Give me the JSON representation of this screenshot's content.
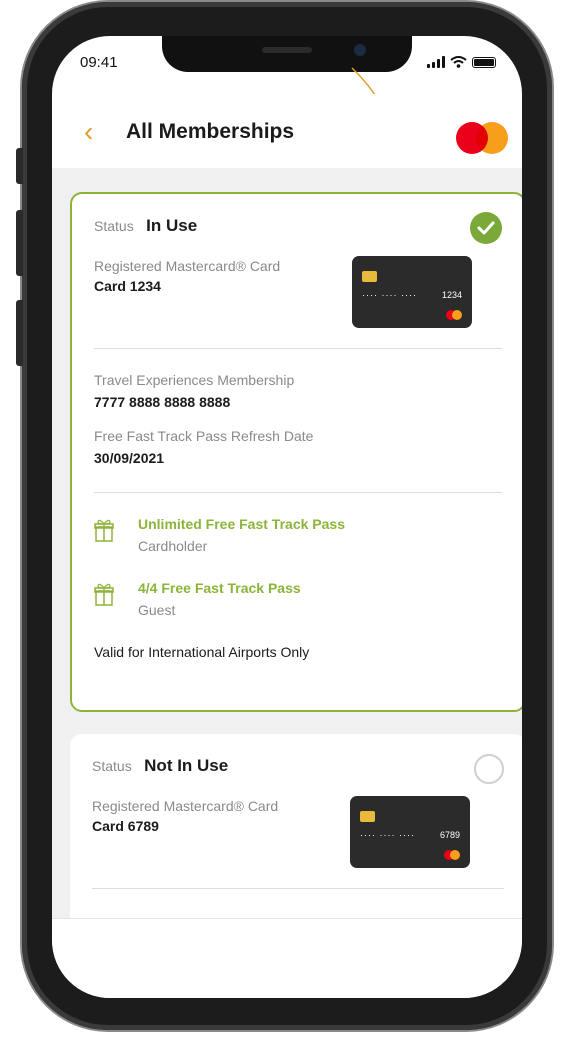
{
  "statusbar": {
    "time": "09:41"
  },
  "header": {
    "back_icon": "‹",
    "title": "All Memberships"
  },
  "colors": {
    "accent": "#e29c2b",
    "green": "#8cb43a",
    "mc_red": "#eb001b",
    "mc_yellow": "#f79e1b"
  },
  "memberships": [
    {
      "status_label": "Status",
      "status": "In Use",
      "card_label": "Registered Mastercard® Card",
      "card_name": "Card 1234",
      "card_dots": "···· ···· ····",
      "card_last4": "1234",
      "membership_label": "Travel Experiences Membership",
      "membership_number": "7777 8888 8888 8888",
      "refresh_label": "Free Fast Track Pass Refresh Date",
      "refresh_date": "30/09/2021",
      "benefits": [
        {
          "title": "Unlimited  Free Fast Track Pass",
          "subtitle": "Cardholder",
          "icon": "gift-icon"
        },
        {
          "title": "4/4 Free Fast Track Pass",
          "subtitle": "Guest",
          "icon": "gift-icon"
        }
      ],
      "note": "Valid for International Airports Only"
    },
    {
      "status_label": "Status",
      "status": "Not In Use",
      "card_label": "Registered Mastercard® Card",
      "card_name": "Card 6789",
      "card_dots": "···· ···· ····",
      "card_last4": "6789"
    }
  ]
}
